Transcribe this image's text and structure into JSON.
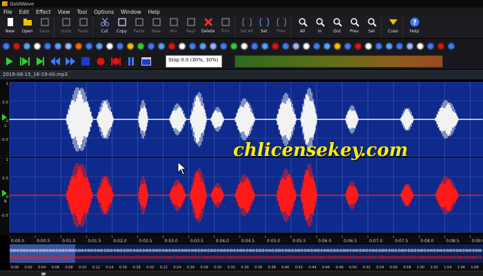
{
  "window": {
    "title": "GoldWave"
  },
  "menu": [
    "File",
    "Edit",
    "Effect",
    "View",
    "Tool",
    "Options",
    "Window",
    "Help"
  ],
  "toolbar_main": [
    {
      "label": "New",
      "icon": "new-file-icon",
      "enabled": true
    },
    {
      "label": "Open",
      "icon": "open-folder-icon",
      "enabled": true
    },
    {
      "label": "Save",
      "icon": "save-icon",
      "enabled": false
    },
    {
      "label": "Undo",
      "icon": "undo-icon",
      "enabled": false
    },
    {
      "label": "Redo",
      "icon": "redo-icon",
      "enabled": false
    },
    {
      "label": "Cut",
      "icon": "scissors-icon",
      "enabled": true
    },
    {
      "label": "Copy",
      "icon": "copy-icon",
      "enabled": true
    },
    {
      "label": "Paste",
      "icon": "paste-icon",
      "enabled": false
    },
    {
      "label": "New",
      "icon": "paste-new-icon",
      "enabled": false
    },
    {
      "label": "Mix",
      "icon": "mix-icon",
      "enabled": false
    },
    {
      "label": "Repl",
      "icon": "replace-icon",
      "enabled": false
    },
    {
      "label": "Delete",
      "icon": "delete-icon",
      "enabled": true
    },
    {
      "label": "Trim",
      "icon": "trim-icon",
      "enabled": false
    },
    {
      "label": "Sel All",
      "icon": "select-all-icon",
      "enabled": false
    },
    {
      "label": "Set",
      "icon": "set-selection-icon",
      "enabled": true
    },
    {
      "label": "Prev",
      "icon": "previous-selection-icon",
      "enabled": false
    },
    {
      "label": "All",
      "icon": "zoom-all-icon",
      "enabled": true
    },
    {
      "label": "In",
      "icon": "zoom-in-icon",
      "enabled": true
    },
    {
      "label": "Out",
      "icon": "zoom-out-icon",
      "enabled": true
    },
    {
      "label": "Prev",
      "icon": "zoom-previous-icon",
      "enabled": true
    },
    {
      "label": "Sel",
      "icon": "zoom-selection-icon",
      "enabled": true
    },
    {
      "label": "Cues",
      "icon": "cues-icon",
      "enabled": true
    },
    {
      "label": "Help",
      "icon": "help-icon",
      "enabled": true
    }
  ],
  "status": {
    "text": "Stop 0.0 (30%, 30%)"
  },
  "file": {
    "name": "2019-08-15_18-19-00.mp3"
  },
  "channel_labels": {
    "left": "L",
    "right": "R",
    "amp_ticks_left": [
      "1",
      "0.5",
      "0",
      "-0.5"
    ],
    "amp_ticks_right": [
      "1",
      "0.5",
      "0",
      "-0.5"
    ]
  },
  "timeline_main": [
    "0:00.0",
    "0:00.5",
    "0:01.0",
    "0:01.5",
    "0:02.0",
    "0:02.5",
    "0:03.0",
    "0:03.5",
    "0:04.0",
    "0:04.5",
    "0:05.0",
    "0:05.5",
    "0:06.0",
    "0:06.5",
    "0:07.0",
    "0:07.5",
    "0:08.0",
    "0:08.5",
    "0:09.0"
  ],
  "timeline_overview": [
    "0:00",
    "0:02",
    "0:04",
    "0:06",
    "0:08",
    "0:10",
    "0:12",
    "0:14",
    "0:16",
    "0:18",
    "0:20",
    "0:22",
    "0:24",
    "0:26",
    "0:28",
    "0:30",
    "0:32",
    "0:34",
    "0:36",
    "0:38",
    "0:40",
    "0:42",
    "0:44",
    "0:46",
    "0:48",
    "0:50",
    "0:52",
    "0:54",
    "0:56",
    "0:58",
    "1:00",
    "1:02",
    "1:04",
    "1:06",
    "1:08"
  ],
  "watermark": "chlicensekey.com",
  "colors": {
    "wave_bg": "#0e2a8c",
    "left_wave": "#f2f2f2",
    "right_wave": "#ff1a1a",
    "grid": "#6c8be0",
    "accent": "#f2c200"
  }
}
